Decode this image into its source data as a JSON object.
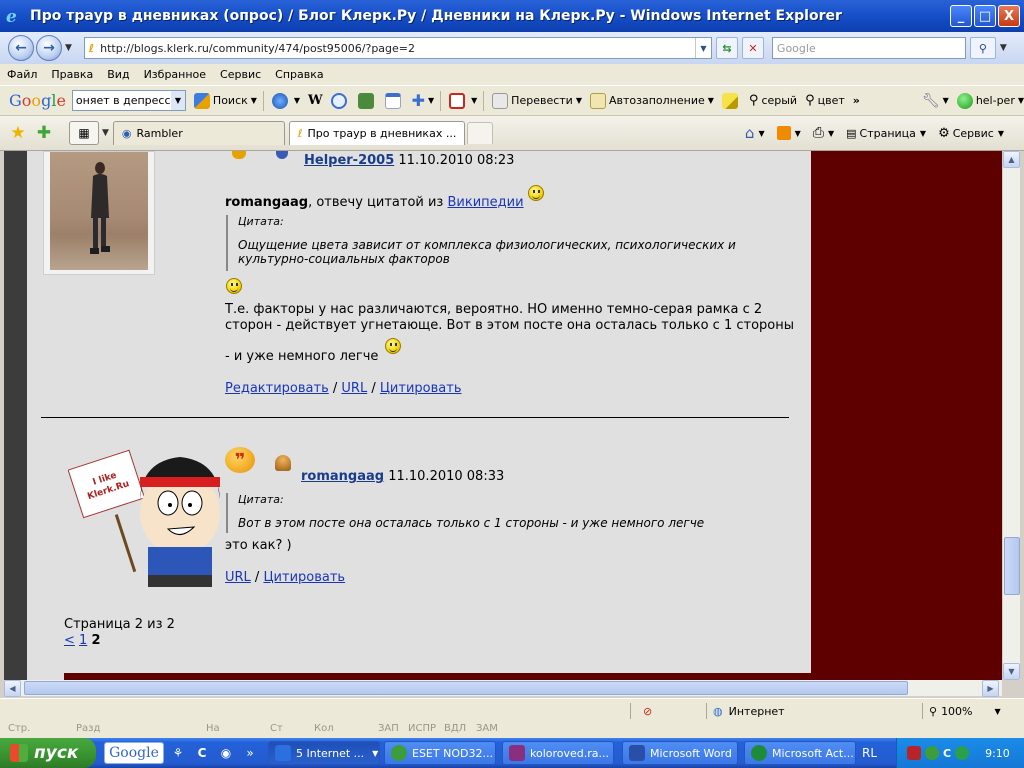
{
  "window": {
    "title": "Про траур в дневниках (опрос) / Блог Клерк.Ру / Дневники на Клерк.Ру - Windows Internet Explorer",
    "min_glyph": "_",
    "max_glyph": "□",
    "close_glyph": "X"
  },
  "address": {
    "url": "http://blogs.klerk.ru/community/474/post95006/?page=2",
    "search_placeholder": "Google"
  },
  "menu": [
    "Файл",
    "Правка",
    "Вид",
    "Избранное",
    "Сервис",
    "Справка"
  ],
  "google_toolbar": {
    "logo_letters": [
      "G",
      "o",
      "o",
      "g",
      "l",
      "e"
    ],
    "query": "оняет в депрессию",
    "search_label": "Поиск",
    "translate_label": "Перевести",
    "autofill_label": "Автозаполнение",
    "grey_label": "серый",
    "color_label": "цвет",
    "more": "»",
    "user": "hel-per"
  },
  "tabs": {
    "items": [
      {
        "label": "Rambler"
      },
      {
        "label": "Про траур в дневниках ..."
      }
    ],
    "close_glyph": "×",
    "page_label": "Страница",
    "tools_label": "Сервис"
  },
  "post1": {
    "author": "Helper-2005",
    "date": "11.10.2010 08:23",
    "intro_user": "romangaag",
    "intro_text": ", отвечу цитатой из ",
    "intro_link": "Википедии",
    "quote_label": "Цитата:",
    "quote_text_1": "Ощущение цвета зависит от комплекса физиологических, психологических и",
    "quote_text_2": "культурно-социальных факторов",
    "body_1": "Т.е. факторы у нас различаются, вероятно. НО именно темно-серая рамка с 2",
    "body_2": "сторон - действует угнетающе. Вот в этом посте она осталась только с 1 стороны",
    "body_3": "- и уже немного легче",
    "link_edit": "Редактировать",
    "link_url": "URL",
    "link_quote": "Цитировать",
    "sep": " / "
  },
  "post2": {
    "author": "romangaag",
    "date": "11.10.2010 08:33",
    "quote_label": "Цитата:",
    "quote_text": "Вот в этом посте она осталась только с 1 стороны - и уже немного легче",
    "body": "это как? )",
    "link_url": "URL",
    "link_quote": "Цитировать",
    "sep": " / ",
    "sign_text": "I like Klerk.Ru"
  },
  "pagination": {
    "label": "Страница 2 из 2",
    "prev": "<",
    "page1": "1",
    "current": "2"
  },
  "status": {
    "zone": "Интернет",
    "zoom": "100%"
  },
  "office_strip": [
    "Стр.",
    "Разд",
    "На",
    "Ст",
    "Кол",
    "ЗАП",
    "ИСПР",
    "ВДЛ",
    "ЗАМ"
  ],
  "taskbar": {
    "start": "пуск",
    "google": "Google",
    "tasks": [
      {
        "label": "5 Internet ...",
        "color": "#2b6fe0"
      },
      {
        "label": "ESET NOD32...",
        "color": "#3c9d3a"
      },
      {
        "label": "koloroved.ra...",
        "color": "#8a2f7d"
      },
      {
        "label": "Microsoft Word",
        "color": "#2a4fa8"
      },
      {
        "label": "Microsoft Act...",
        "color": "#1f8a3a"
      }
    ],
    "lang": "RL",
    "clock": "9:10"
  },
  "colors": {
    "titlebar": "#1750c9",
    "sidebar_dark": "#5e0000",
    "link": "#1a36b8"
  }
}
